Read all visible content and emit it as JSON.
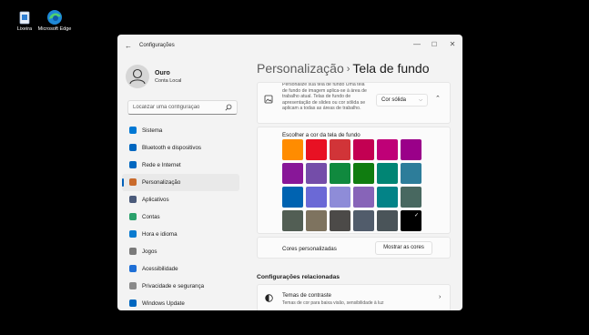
{
  "desktop": {
    "icons": [
      {
        "label": "Lixeira",
        "icon": "recycle-bin-icon"
      },
      {
        "label": "Microsoft Edge",
        "icon": "edge-icon"
      }
    ]
  },
  "window": {
    "title": "Configurações",
    "back_icon": "back-arrow-icon",
    "controls": {
      "minimize": "—",
      "maximize": "☐",
      "close": "✕"
    }
  },
  "user": {
    "name": "Ouro",
    "account": "Conta Local"
  },
  "search": {
    "placeholder": "Localizar uma configuração",
    "value": ""
  },
  "nav": {
    "items": [
      {
        "label": "Sistema",
        "icon": "system-icon",
        "color": "#0078d4"
      },
      {
        "label": "Bluetooth e dispositivos",
        "icon": "bluetooth-icon",
        "color": "#0067c0"
      },
      {
        "label": "Rede e Internet",
        "icon": "network-icon",
        "color": "#0067c0"
      },
      {
        "label": "Personalização",
        "icon": "brush-icon",
        "color": "#c96a2b",
        "active": true
      },
      {
        "label": "Aplicativos",
        "icon": "apps-icon",
        "color": "#4a5a7a"
      },
      {
        "label": "Contas",
        "icon": "accounts-icon",
        "color": "#2aa06b"
      },
      {
        "label": "Hora e idioma",
        "icon": "time-language-icon",
        "color": "#0a7bd0"
      },
      {
        "label": "Jogos",
        "icon": "gaming-icon",
        "color": "#7a7a7a"
      },
      {
        "label": "Acessibilidade",
        "icon": "accessibility-icon",
        "color": "#1f6fd6"
      },
      {
        "label": "Privacidade e segurança",
        "icon": "shield-icon",
        "color": "#8a8a8a"
      },
      {
        "label": "Windows Update",
        "icon": "update-icon",
        "color": "#0067c0"
      }
    ]
  },
  "breadcrumb": {
    "parent": "Personalização",
    "separator": "›",
    "current": "Tela de fundo"
  },
  "fill_card": {
    "description": "Personalize sua tela de fundo Uma tela de fundo de imagem aplica-se à área de trabalho atual. Telas de fundo de apresentação de slides ou cor sólida se aplicam a todas as áreas de trabalho.",
    "select_value": "Cor sólida"
  },
  "colors_card": {
    "label": "Escolher a cor da tela de fundo",
    "selected_index": 23,
    "swatches": [
      "#ff8c00",
      "#e81123",
      "#d13438",
      "#c30052",
      "#bf0077",
      "#9a0089",
      "#881798",
      "#744da9",
      "#10893e",
      "#107c10",
      "#018574",
      "#2d7d9a",
      "#0063b1",
      "#6b69d6",
      "#8e8cd8",
      "#8764b8",
      "#038387",
      "#486860",
      "#525e54",
      "#7e735f",
      "#4c4a48",
      "#515c6b",
      "#4a5459",
      "#000000"
    ]
  },
  "custom_colors": {
    "label": "Cores personalizadas",
    "button": "Mostrar as cores"
  },
  "related": {
    "title": "Configurações relacionadas",
    "contrast": {
      "title": "Temas de contraste",
      "subtitle": "Temas de cor para baixa visão, sensibilidade à luz"
    }
  }
}
